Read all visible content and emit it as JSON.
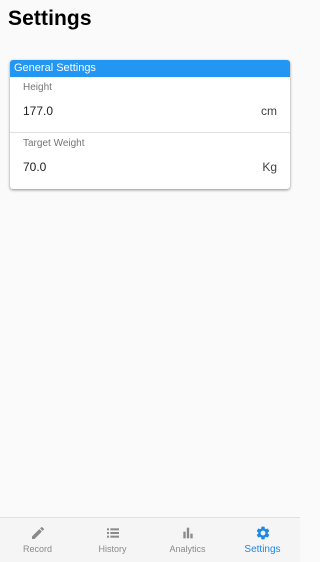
{
  "page": {
    "title": "Settings"
  },
  "general_settings": {
    "header": "General Settings",
    "fields": [
      {
        "label": "Height",
        "value": "177.0",
        "unit": "cm"
      },
      {
        "label": "Target Weight",
        "value": "70.0",
        "unit": "Kg"
      }
    ]
  },
  "bottom_nav": {
    "items": [
      {
        "label": "Record",
        "icon": "pencil-icon",
        "active": false
      },
      {
        "label": "History",
        "icon": "list-icon",
        "active": false
      },
      {
        "label": "Analytics",
        "icon": "bar-chart-icon",
        "active": false
      },
      {
        "label": "Settings",
        "icon": "gear-icon",
        "active": true
      }
    ]
  },
  "colors": {
    "accent": "#2196f3",
    "active_nav": "#1e88e5",
    "inactive_nav": "#8a8a8a"
  }
}
